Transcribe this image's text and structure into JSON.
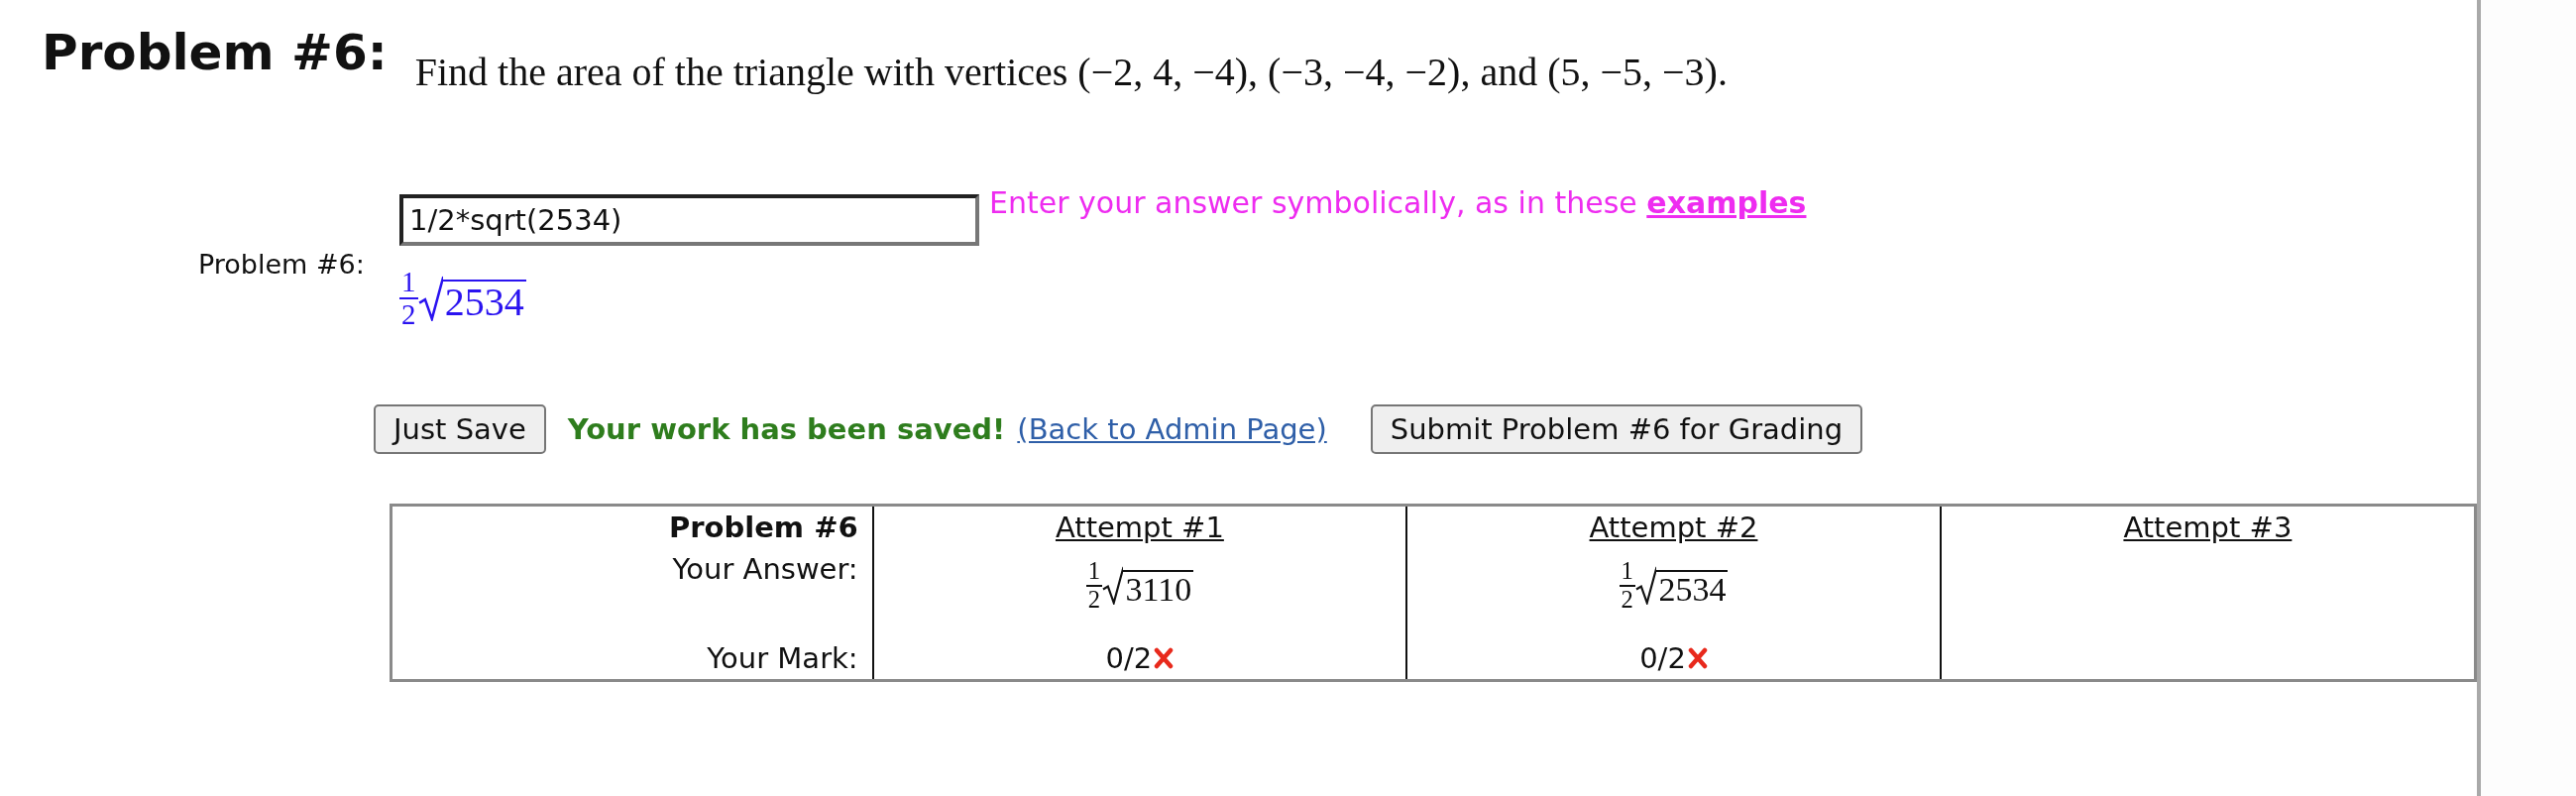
{
  "problem_title": "Problem #6:",
  "question": "Find the area of the triangle with vertices (−2, 4, −4), (−3, −4, −2), and (5, −5, −3).",
  "answer_label": "Problem #6:",
  "answer_field": {
    "value": "1/2*sqrt(2534)"
  },
  "preview": {
    "numerator": "1",
    "denominator": "2",
    "radicand": "2534"
  },
  "hint": {
    "text": "Enter your answer symbolically, as in these",
    "link": "examples"
  },
  "save_button": "Just Save",
  "saved_message": "Your work has been saved!",
  "back_link": "(Back to Admin Page)",
  "submit_button": "Submit Problem #6 for Grading",
  "attempts_table": {
    "title": "Problem #6",
    "answer_label": "Your Answer:",
    "mark_label": "Your Mark:",
    "attempts": [
      {
        "label": "Attempt #1",
        "answer": {
          "numerator": "1",
          "denominator": "2",
          "radicand": "3110"
        },
        "mark": "0/2",
        "correct": false
      },
      {
        "label": "Attempt #2",
        "answer": {
          "numerator": "1",
          "denominator": "2",
          "radicand": "2534"
        },
        "mark": "0/2",
        "correct": false
      },
      {
        "label": "Attempt #3"
      }
    ]
  }
}
